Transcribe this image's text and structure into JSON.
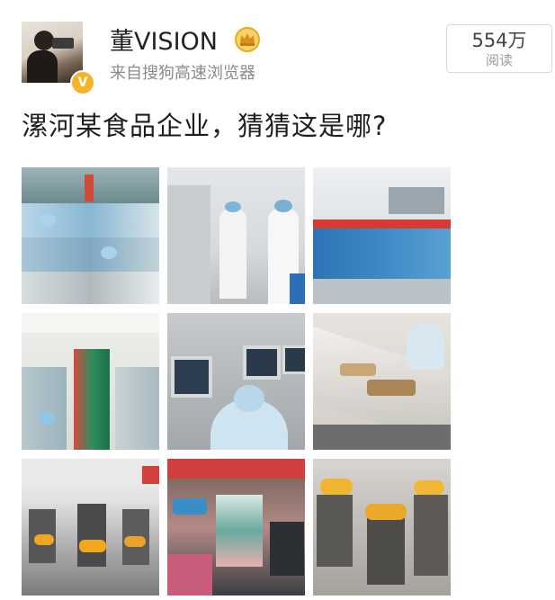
{
  "post": {
    "username": "董VISION",
    "source": "来自搜狗高速浏览器",
    "read_count": "554万",
    "read_label": "阅读",
    "text": "漯河某食品企业，猜猜这是哪?",
    "icons": {
      "verified": "verified-v-badge-icon",
      "member": "crown-member-icon"
    },
    "accent_colors": {
      "verified_badge": "#f4b42a",
      "crown": "#e9a91f"
    },
    "images": [
      {
        "name": "photo-factory-collage"
      },
      {
        "name": "photo-lab-workers"
      },
      {
        "name": "photo-production-hall"
      },
      {
        "name": "photo-conveyor-line"
      },
      {
        "name": "photo-control-panels"
      },
      {
        "name": "photo-food-conveyor"
      },
      {
        "name": "photo-packing-machines"
      },
      {
        "name": "photo-colorful-machinery"
      },
      {
        "name": "photo-weighing-machines"
      }
    ]
  }
}
